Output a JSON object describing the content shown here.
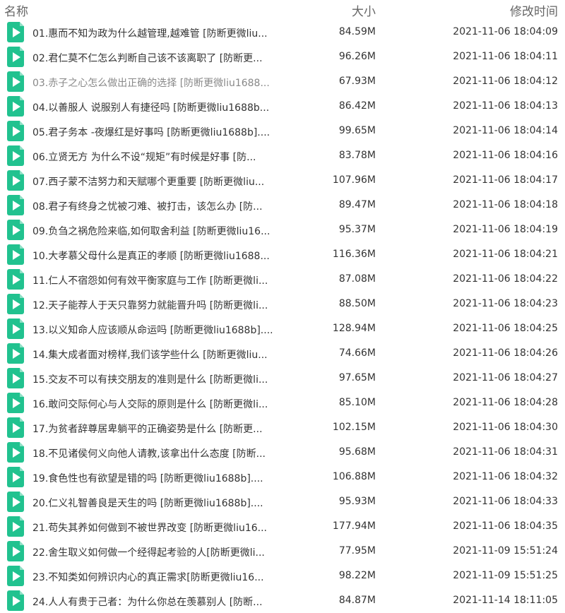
{
  "header": {
    "name": "名称",
    "size": "大小",
    "time": "修改时间"
  },
  "icon": "video-file-icon",
  "accent": "#21c28f",
  "files": [
    {
      "name": "01.惠而不知为政为什么越管理,越难管 [防断更微liu...",
      "size": "84.59M",
      "time": "2021-11-06 18:04:09"
    },
    {
      "name": "02.君仁莫不仁怎么判断自己该不该离职了 [防断更...",
      "size": "96.26M",
      "time": "2021-11-06 18:04:11"
    },
    {
      "name": "03.赤子之心怎么做出正确的选择 [防断更微liu1688...",
      "size": "67.93M",
      "time": "2021-11-06 18:04:12"
    },
    {
      "name": "04.以善服人 说服别人有捷径吗 [防断更微liu1688b...",
      "size": "86.42M",
      "time": "2021-11-06 18:04:13"
    },
    {
      "name": "05.君子务本 -夜爆红是好事吗 [防断更微liu1688b]....",
      "size": "99.65M",
      "time": "2021-11-06 18:04:14"
    },
    {
      "name": "06.立贤无方 为什么不设“规矩”有时候是好事 [防...",
      "size": "83.78M",
      "time": "2021-11-06 18:04:16"
    },
    {
      "name": "07.西子蒙不洁努力和天赋哪个更重要 [防断更微liu...",
      "size": "107.96M",
      "time": "2021-11-06 18:04:17"
    },
    {
      "name": "08.君子有终身之忧被刁难、被打击，该怎么办 [防...",
      "size": "89.47M",
      "time": "2021-11-06 18:04:18"
    },
    {
      "name": "09.负刍之祸危险来临,如何取舍利益 [防断更微liu16...",
      "size": "95.37M",
      "time": "2021-11-06 18:04:19"
    },
    {
      "name": "10.大孝慕父母什么是真正的孝顺 [防断更微liu1688...",
      "size": "116.36M",
      "time": "2021-11-06 18:04:21"
    },
    {
      "name": "11.仁人不宿怨如何有效平衡家庭与工作 [防断更微li...",
      "size": "87.08M",
      "time": "2021-11-06 18:04:22"
    },
    {
      "name": "12.天子能荐人于天只靠努力就能晋升吗 [防断更微li...",
      "size": "88.50M",
      "time": "2021-11-06 18:04:23"
    },
    {
      "name": "13.以义知命人应该顺从命运吗 [防断更微liu1688b]....",
      "size": "128.94M",
      "time": "2021-11-06 18:04:25"
    },
    {
      "name": "14.集大成者面对榜样,我们该学些什么 [防断更微liu...",
      "size": "74.66M",
      "time": "2021-11-06 18:04:26"
    },
    {
      "name": "15.交友不可以有挟交朋友的准则是什么 [防断更微li...",
      "size": "97.65M",
      "time": "2021-11-06 18:04:27"
    },
    {
      "name": "16.敢问交际何心与人交际的原则是什么 [防断更微li...",
      "size": "85.10M",
      "time": "2021-11-06 18:04:28"
    },
    {
      "name": "17.为贫者辞尊居卑躺平的正确姿势是什么 [防断更...",
      "size": "102.15M",
      "time": "2021-11-06 18:04:30"
    },
    {
      "name": "18.不见诸侯何义向他人请教,该拿出什么态度 [防断...",
      "size": "95.68M",
      "time": "2021-11-06 18:04:31"
    },
    {
      "name": "19.食色性也有欲望是错的吗 [防断更微liu1688b]....",
      "size": "106.88M",
      "time": "2021-11-06 18:04:32"
    },
    {
      "name": "20.仁义礼智善良是天生的吗 [防断更微liu1688b]....",
      "size": "95.93M",
      "time": "2021-11-06 18:04:33"
    },
    {
      "name": "21.苟失其养如何做到不被世界改变 [防断更微liu16...",
      "size": "177.94M",
      "time": "2021-11-06 18:04:35"
    },
    {
      "name": "22.舍生取义如何做一个经得起考验的人[防断更微li...",
      "size": "77.95M",
      "time": "2021-11-09 15:51:24"
    },
    {
      "name": "23.不知类如何辨识内心的真正需求[防断更微liu16...",
      "size": "98.22M",
      "time": "2021-11-09 15:51:25"
    },
    {
      "name": "24.人人有贵于己者：为什么你总在羡慕别人 [防断...",
      "size": "84.87M",
      "time": "2021-11-14 18:11:05"
    }
  ]
}
